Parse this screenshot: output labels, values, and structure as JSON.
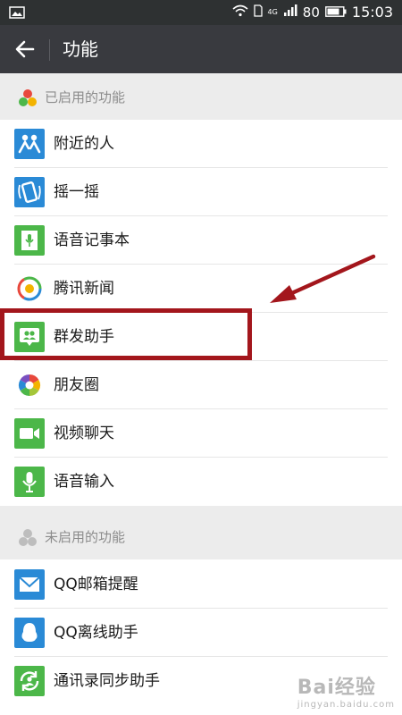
{
  "status_bar": {
    "network": "4G",
    "battery": "80",
    "time": "15:03"
  },
  "title_bar": {
    "title": "功能"
  },
  "enabled_section": {
    "header": "已启用的功能"
  },
  "enabled_items": [
    {
      "label": "附近的人",
      "icon": "people-nearby-icon"
    },
    {
      "label": "摇一摇",
      "icon": "shake-icon"
    },
    {
      "label": "语音记事本",
      "icon": "voice-notepad-icon"
    },
    {
      "label": "腾讯新闻",
      "icon": "tencent-news-icon"
    },
    {
      "label": "群发助手",
      "icon": "broadcast-assistant-icon"
    },
    {
      "label": "朋友圈",
      "icon": "moments-icon"
    },
    {
      "label": "视频聊天",
      "icon": "video-chat-icon"
    },
    {
      "label": "语音输入",
      "icon": "voice-input-icon"
    }
  ],
  "disabled_section": {
    "header": "未启用的功能"
  },
  "disabled_items": [
    {
      "label": "QQ邮箱提醒",
      "icon": "qq-mail-icon"
    },
    {
      "label": "QQ离线助手",
      "icon": "qq-offline-icon"
    },
    {
      "label": "通讯录同步助手",
      "icon": "contacts-sync-icon"
    }
  ],
  "watermark": {
    "text": "Bai",
    "text2": "经验",
    "sub": "jingyan.baidu.com"
  },
  "colors": {
    "wechat_green": "#4cb749",
    "blue": "#2a8ad6",
    "highlight_red": "#a3161c",
    "titlebar": "#393a3f"
  }
}
